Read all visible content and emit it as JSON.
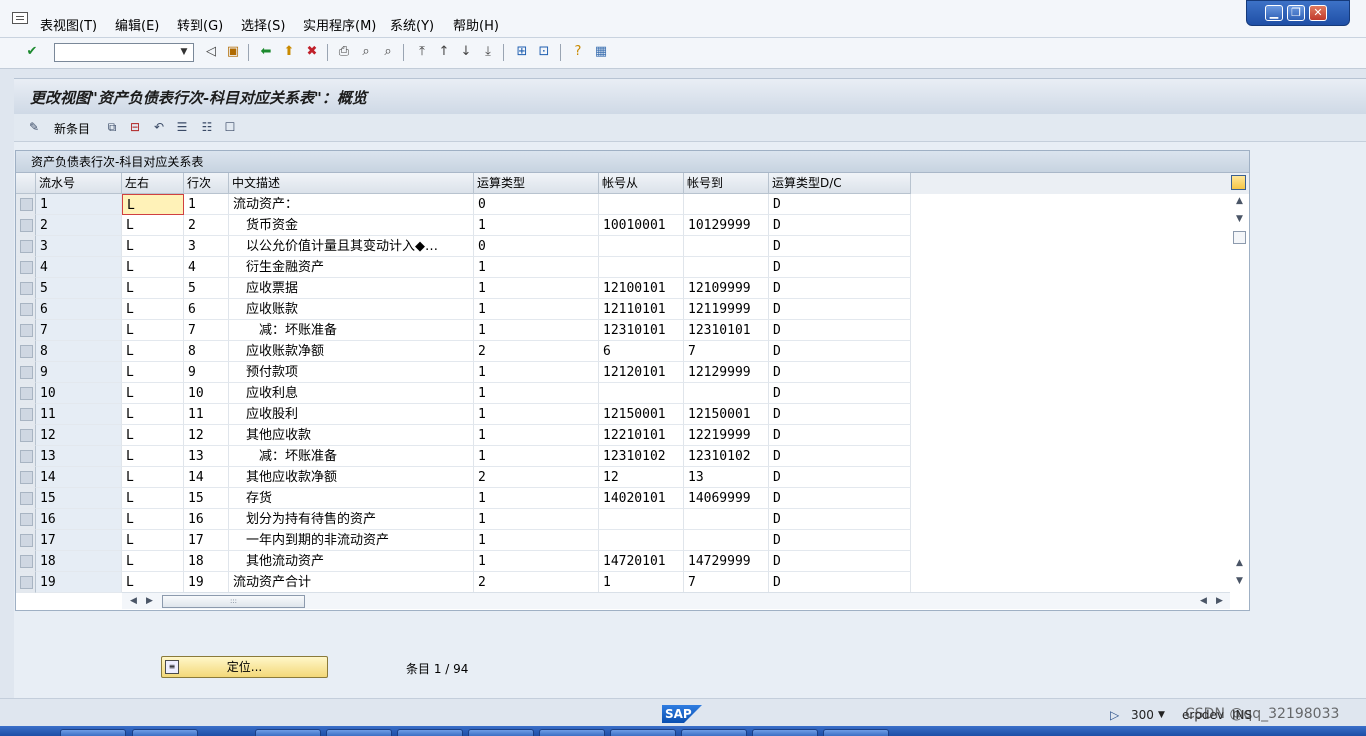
{
  "menu": [
    "表视图(T)",
    "编辑(E)",
    "转到(G)",
    "选择(S)",
    "实用程序(M)",
    "系统(Y)",
    "帮助(H)"
  ],
  "window_controls": {
    "minimize": "▁",
    "restore": "❐",
    "close": "✕"
  },
  "toolbar": {
    "command_value": ""
  },
  "title": "更改视图\"资产负债表行次-科目对应关系表\"：概览",
  "app_toolbar": {
    "new_entries_label": "新条目"
  },
  "table": {
    "caption": "资产负债表行次-科目对应关系表",
    "columns": [
      "流水号",
      "左右",
      "行次",
      "中文描述",
      "运算类型",
      "帐号从",
      "帐号到",
      "运算类型D/C"
    ],
    "rows": [
      [
        "1",
        "L",
        "1",
        "流动资产：",
        "0",
        "",
        "",
        "D"
      ],
      [
        "2",
        "L",
        "2",
        "　货币资金",
        "1",
        "10010001",
        "10129999",
        "D"
      ],
      [
        "3",
        "L",
        "3",
        "　以公允价值计量且其变动计入◆…",
        "0",
        "",
        "",
        "D"
      ],
      [
        "4",
        "L",
        "4",
        "　衍生金融资产",
        "1",
        "",
        "",
        "D"
      ],
      [
        "5",
        "L",
        "5",
        "　应收票据",
        "1",
        "12100101",
        "12109999",
        "D"
      ],
      [
        "6",
        "L",
        "6",
        "　应收账款",
        "1",
        "12110101",
        "12119999",
        "D"
      ],
      [
        "7",
        "L",
        "7",
        "　　减：坏账准备",
        "1",
        "12310101",
        "12310101",
        "D"
      ],
      [
        "8",
        "L",
        "8",
        "　应收账款净额",
        "2",
        "6",
        "7",
        "D"
      ],
      [
        "9",
        "L",
        "9",
        "　预付款项",
        "1",
        "12120101",
        "12129999",
        "D"
      ],
      [
        "10",
        "L",
        "10",
        "　应收利息",
        "1",
        "",
        "",
        "D"
      ],
      [
        "11",
        "L",
        "11",
        "　应收股利",
        "1",
        "12150001",
        "12150001",
        "D"
      ],
      [
        "12",
        "L",
        "12",
        "　其他应收款",
        "1",
        "12210101",
        "12219999",
        "D"
      ],
      [
        "13",
        "L",
        "13",
        "　　减：坏账准备",
        "1",
        "12310102",
        "12310102",
        "D"
      ],
      [
        "14",
        "L",
        "14",
        "　其他应收款净额",
        "2",
        "12",
        "13",
        "D"
      ],
      [
        "15",
        "L",
        "15",
        "　存货",
        "1",
        "14020101",
        "14069999",
        "D"
      ],
      [
        "16",
        "L",
        "16",
        "　划分为持有待售的资产",
        "1",
        "",
        "",
        "D"
      ],
      [
        "17",
        "L",
        "17",
        "　一年内到期的非流动资产",
        "1",
        "",
        "",
        "D"
      ],
      [
        "18",
        "L",
        "18",
        "　其他流动资产",
        "1",
        "14720101",
        "14729999",
        "D"
      ],
      [
        "19",
        "L",
        "19",
        "流动资产合计",
        "2",
        "1",
        "7",
        "D"
      ]
    ]
  },
  "position_button": "定位...",
  "entry_info": "条目 1 / 94",
  "status": {
    "system_value": "300",
    "user": "erpdev",
    "server": "INS",
    "watermark": "CSDN @qq_32198033"
  }
}
